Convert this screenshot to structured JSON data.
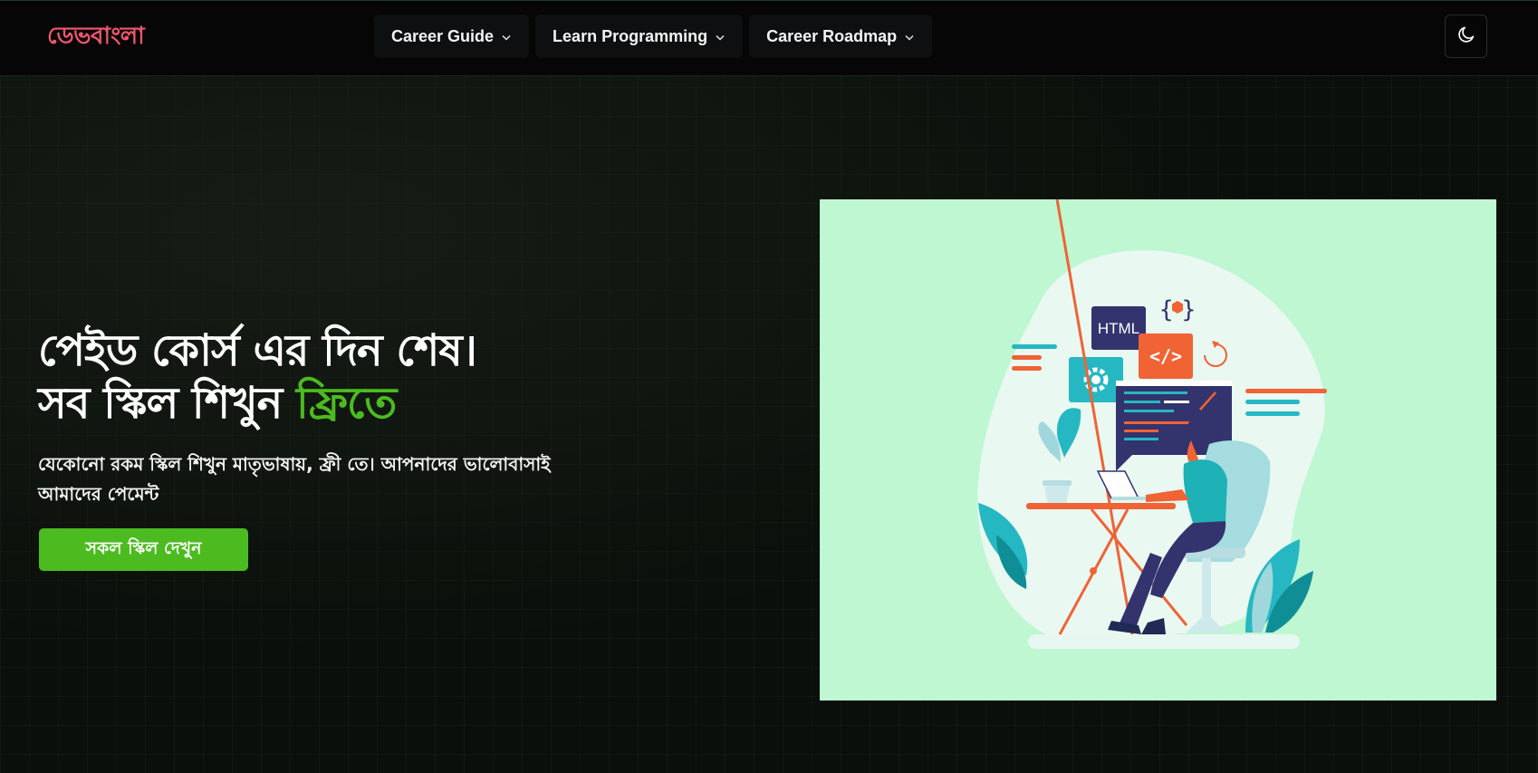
{
  "brand": {
    "name": "ডেভবাংলা",
    "color": "#f0566e"
  },
  "nav": {
    "items": [
      {
        "label": "Career Guide"
      },
      {
        "label": "Learn Programming"
      },
      {
        "label": "Career Roadmap"
      }
    ],
    "theme_toggle_icon": "moon-icon",
    "dropdown_icon": "chevron-down-icon"
  },
  "hero": {
    "title_line1": "পেইড কোর্স এর দিন শেষ।",
    "title_line2_prefix": "সব স্কিল শিখুন ",
    "title_line2_accent": "ফ্রিতে",
    "subtitle": "যেকোনো রকম স্কিল শিখুন মাতৃভাষায়, ফ্রী তে। আপনাদের ভালোবাসাই আমাদের পেমেন্ট",
    "cta_label": "সকল স্কিল দেখুন",
    "accent_color": "#4cbb1f"
  },
  "illustration": {
    "html_tag": "HTML",
    "code_symbol": "</>",
    "braces": "{ }",
    "background_color": "#bef7d2"
  }
}
